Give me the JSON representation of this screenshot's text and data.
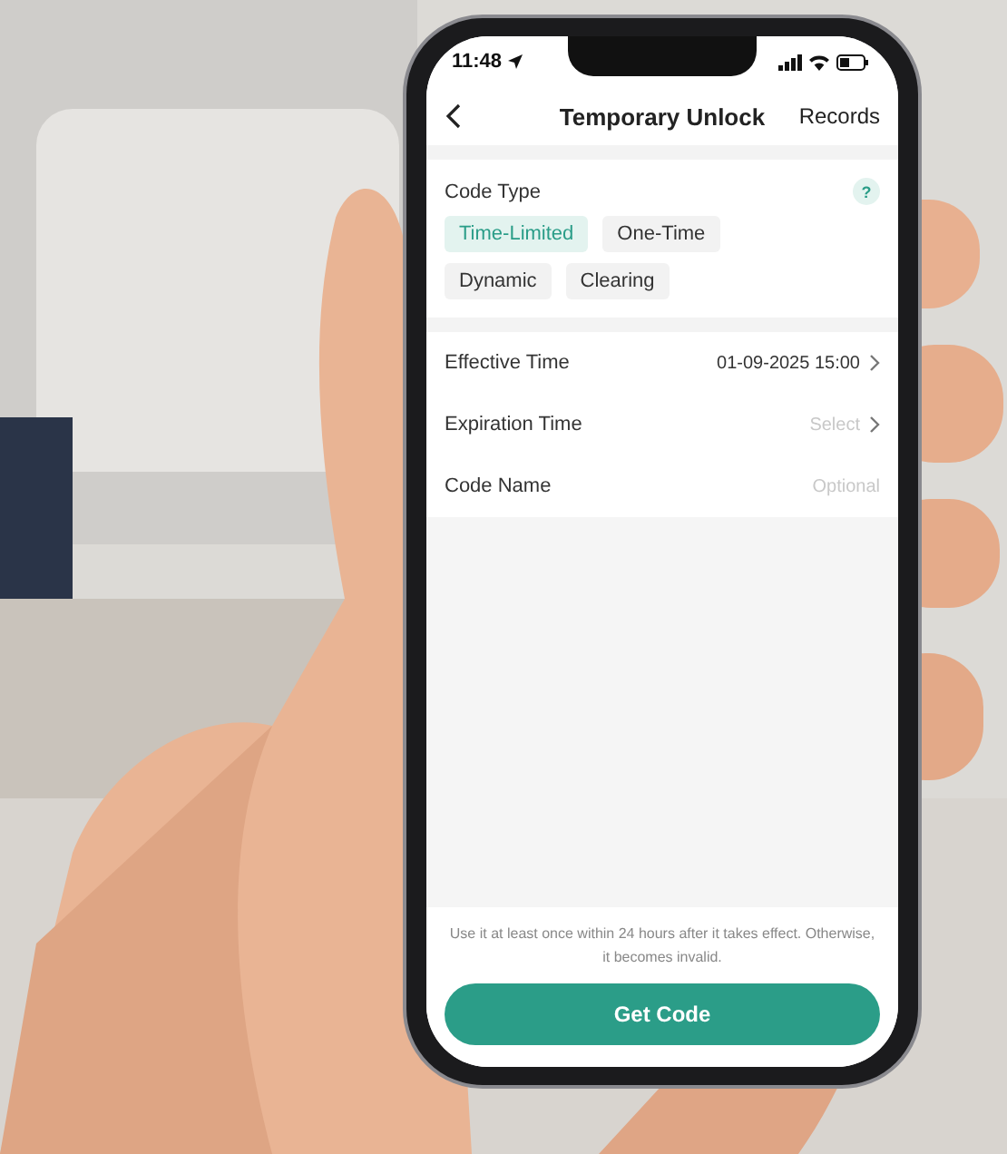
{
  "status_bar": {
    "time": "11:48"
  },
  "nav": {
    "title": "Temporary Unlock",
    "action": "Records"
  },
  "code_type": {
    "label": "Code Type",
    "help": "?",
    "options": [
      {
        "label": "Time-Limited",
        "selected": true
      },
      {
        "label": "One-Time",
        "selected": false
      },
      {
        "label": "Dynamic",
        "selected": false
      },
      {
        "label": "Clearing",
        "selected": false
      }
    ]
  },
  "fields": [
    {
      "kind": "picker",
      "label": "Effective Time",
      "value": "01-09-2025 15:00"
    },
    {
      "kind": "picker",
      "label": "Expiration Time",
      "placeholder": "Select"
    },
    {
      "kind": "input",
      "label": "Code Name",
      "placeholder": "Optional"
    }
  ],
  "note": "Use it at least once within 24 hours after it takes effect. Otherwise, it becomes invalid.",
  "button": "Get Code"
}
